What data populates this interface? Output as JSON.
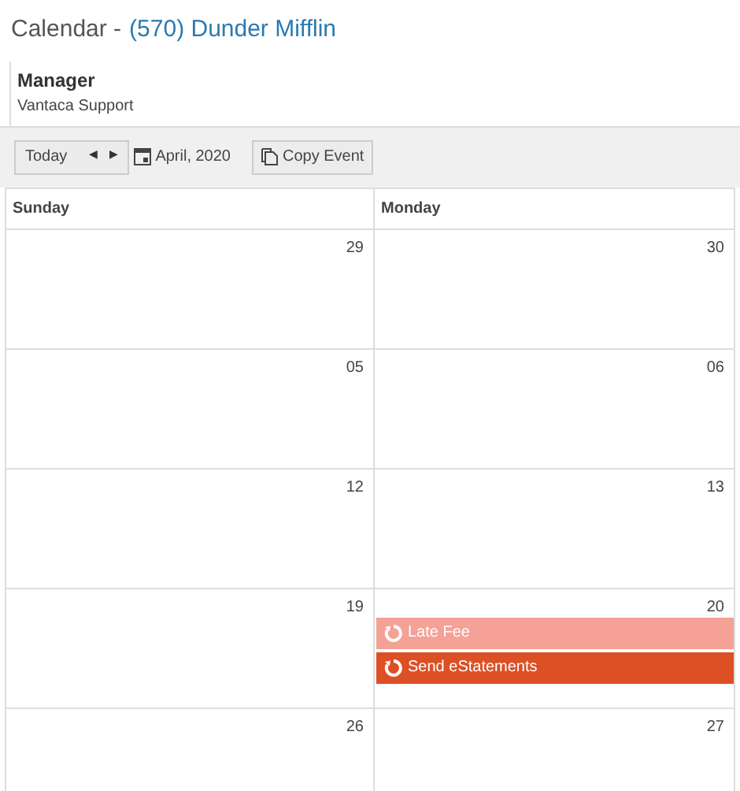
{
  "title": {
    "label": "Calendar -",
    "company": "(570) Dunder Mifflin"
  },
  "manager": {
    "heading": "Manager",
    "name": "Vantaca Support"
  },
  "toolbar": {
    "today": "Today",
    "prev": "◀",
    "next": "▶",
    "month": "April, 2020",
    "copy": "Copy Event"
  },
  "columns": [
    "Sunday",
    "Monday"
  ],
  "weeks": [
    {
      "days": [
        {
          "day": "29"
        },
        {
          "day": "30"
        }
      ]
    },
    {
      "days": [
        {
          "day": "05"
        },
        {
          "day": "06"
        }
      ]
    },
    {
      "days": [
        {
          "day": "12"
        },
        {
          "day": "13"
        }
      ]
    },
    {
      "days": [
        {
          "day": "19"
        },
        {
          "day": "20",
          "events": [
            {
              "label": "Late Fee",
              "color": "#f5a196"
            },
            {
              "label": "Send eStatements",
              "color": "#dd4f24"
            }
          ]
        }
      ]
    },
    {
      "days": [
        {
          "day": "26"
        },
        {
          "day": "27"
        }
      ]
    }
  ]
}
